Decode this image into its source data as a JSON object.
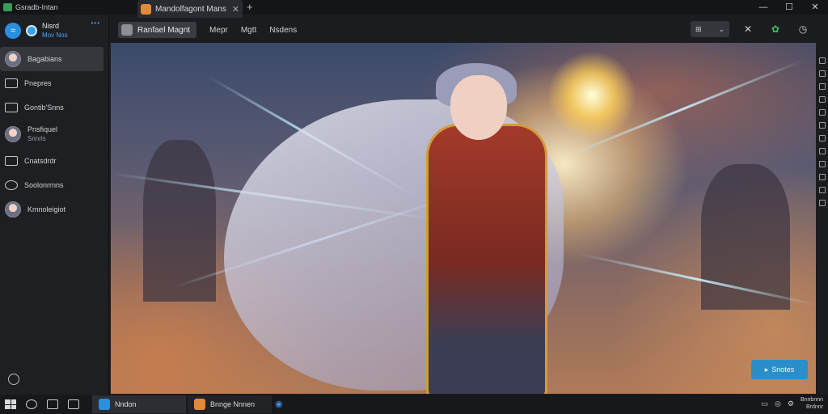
{
  "window": {
    "app_title": "Gsradb-Intan",
    "tab_title": "Mandolfagont Mans",
    "tab_close": "✕",
    "new_tab": "+",
    "controls": [
      "—",
      "☐",
      "✕"
    ]
  },
  "sidebar": {
    "account_name": "Nisrd",
    "account_status": "Mov Nos",
    "more": "•••",
    "items": [
      {
        "label": "Bagabians",
        "sub": "",
        "icon": "avatar"
      },
      {
        "label": "Pnepres",
        "sub": "",
        "icon": "image-icon"
      },
      {
        "label": "Gontib'Snns",
        "sub": "",
        "icon": "monitor-icon"
      },
      {
        "label": "Pnsfiquel",
        "sub": "Snnris",
        "icon": "avatar"
      },
      {
        "label": "Cnatsdrdr",
        "sub": "",
        "icon": "document-icon"
      },
      {
        "label": "Soolonrrnns",
        "sub": "",
        "icon": "chat-icon"
      },
      {
        "label": "Kmnoleigiot",
        "sub": "",
        "icon": "avatar"
      }
    ]
  },
  "toolbar": {
    "active_label": "Ranfael Magnt",
    "links": [
      "Mepr",
      "Mgtt",
      "Nsdens"
    ],
    "view_label": "⊞",
    "view_chevron": "⌄"
  },
  "canvas": {
    "start_button": "Snotes"
  },
  "taskbar": {
    "app1_label": "Nndon",
    "app2_label": "Bnnge Nnnen",
    "tray_time": "Bnnbnnn",
    "tray_date": "Brdnnr"
  },
  "colors": {
    "accent": "#2b8ec9",
    "sidebar_bg": "#1e1f23",
    "active_item": "#35373c"
  }
}
